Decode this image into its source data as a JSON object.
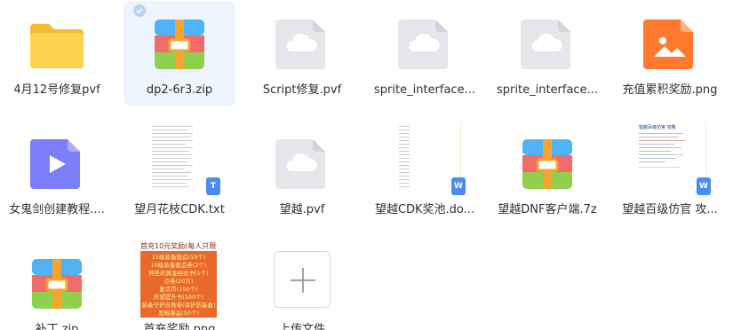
{
  "files": [
    {
      "name": "4月12号修复pvf",
      "type": "folder"
    },
    {
      "name": "dp2-6r3.zip",
      "type": "archive",
      "selected": true
    },
    {
      "name": "Script修复.pvf",
      "type": "unknown"
    },
    {
      "name": "sprite_interface...",
      "type": "unknown"
    },
    {
      "name": "sprite_interface...",
      "type": "unknown"
    },
    {
      "name": "充值累积奖励.png",
      "type": "image"
    },
    {
      "name": "女鬼剑创建教程....",
      "type": "video"
    },
    {
      "name": "望月花枝CDK.txt",
      "type": "text",
      "badge": "T"
    },
    {
      "name": "望越.pvf",
      "type": "unknown"
    },
    {
      "name": "望越CDK奖池.do...",
      "type": "word",
      "badge": "W"
    },
    {
      "name": "望越DNF客户端.7z",
      "type": "archive"
    },
    {
      "name": "望越百级仿官 攻...",
      "type": "word",
      "badge": "W",
      "thumb_title": "望越百级仿官 攻略"
    },
    {
      "name": "补丁.zip",
      "type": "archive"
    },
    {
      "name": "首充奖励.png",
      "type": "image-thumb"
    },
    {
      "name": "上传文件",
      "type": "upload"
    }
  ],
  "poster": {
    "title": "首充10元奖励(每人只限一次)",
    "lines": [
      "15级装备锻造(10个)",
      "10级装备锻造券(2个)",
      "神圣的黄金经验书(1个)",
      "点卷(20万)",
      "复活币(100个)",
      "声望提升书(100个)",
      "装备守护自救卷(保护防装备)",
      "黑暗凝晶(50个)"
    ]
  },
  "colors": {
    "selected_bg": "#eef5ff",
    "folder": "#f9d04c",
    "cloud_bg": "#e5e7eb",
    "image_icon": "#ff7a2e",
    "video_icon": "#7d7ef9",
    "word_badge": "#4a8cf7"
  }
}
